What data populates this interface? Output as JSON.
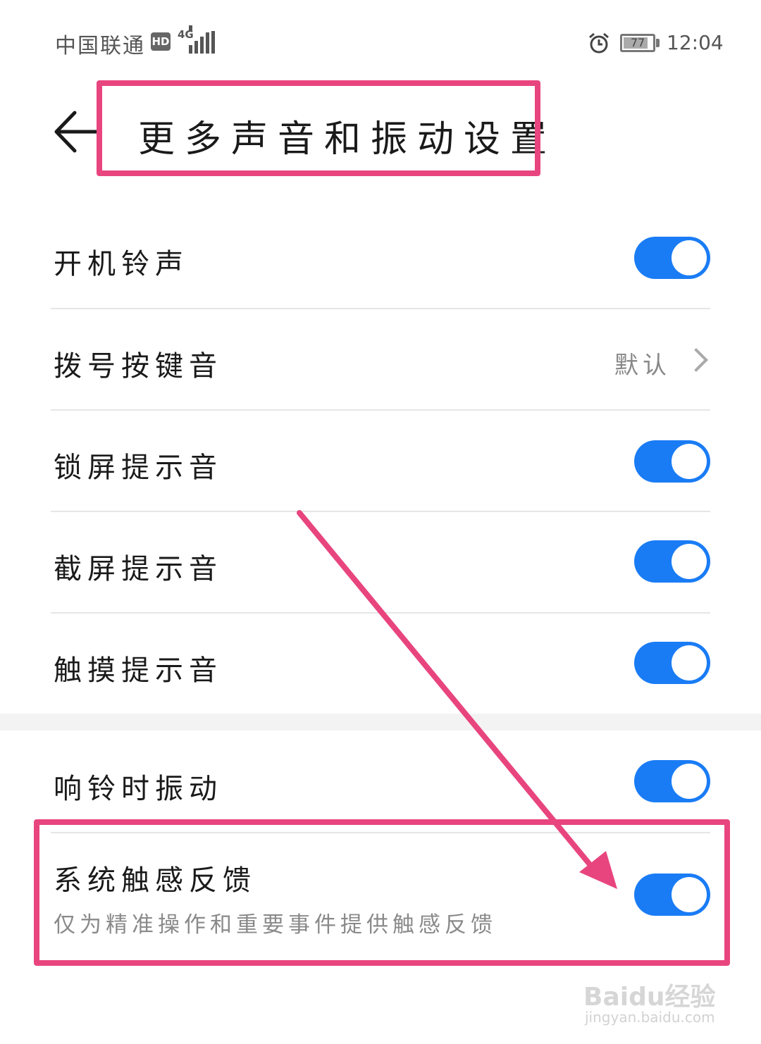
{
  "status_bar": {
    "carrier": "中国联通",
    "hd": "HD",
    "network": "4G",
    "battery": "77",
    "time": "12:04",
    "icons": [
      "hd-icon",
      "signal-icon",
      "alarm-icon",
      "battery-icon"
    ]
  },
  "header": {
    "title": "更多声音和振动设置",
    "back_icon": "back-arrow-icon"
  },
  "settings": [
    {
      "label": "开机铃声",
      "type": "toggle",
      "on": true
    },
    {
      "label": "拨号按键音",
      "type": "link",
      "value": "默认"
    },
    {
      "label": "锁屏提示音",
      "type": "toggle",
      "on": true
    },
    {
      "label": "截屏提示音",
      "type": "toggle",
      "on": true
    },
    {
      "label": "触摸提示音",
      "type": "toggle",
      "on": true
    },
    {
      "label": "响铃时振动",
      "type": "toggle",
      "on": true
    },
    {
      "label": "系统触感反馈",
      "subtitle": "仅为精准操作和重要事件提供触感反馈",
      "type": "toggle",
      "on": true
    }
  ],
  "colors": {
    "toggle_on": "#1a7cf5",
    "annotation": "#e8457e"
  },
  "watermark": {
    "logo": "Baidu经验",
    "url": "jingyan.baidu.com"
  }
}
